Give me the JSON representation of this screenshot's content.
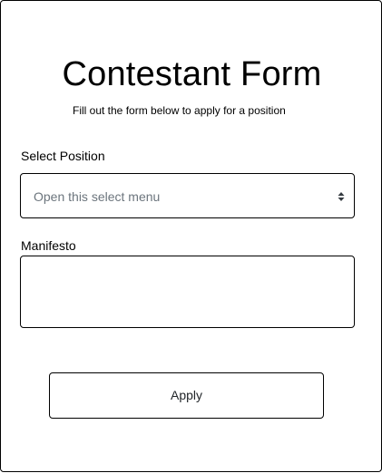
{
  "form": {
    "title": "Contestant Form",
    "subtitle": "Fill out the form below to apply for a position",
    "position_label": "Select Position",
    "position_select": {
      "selected": "Open this select menu",
      "icon": "chevron-up-down-icon"
    },
    "manifesto_label": "Manifesto",
    "manifesto_value": "",
    "apply_label": "Apply"
  },
  "colors": {
    "border": "#000000",
    "placeholder": "#6c757d",
    "background": "#ffffff"
  }
}
